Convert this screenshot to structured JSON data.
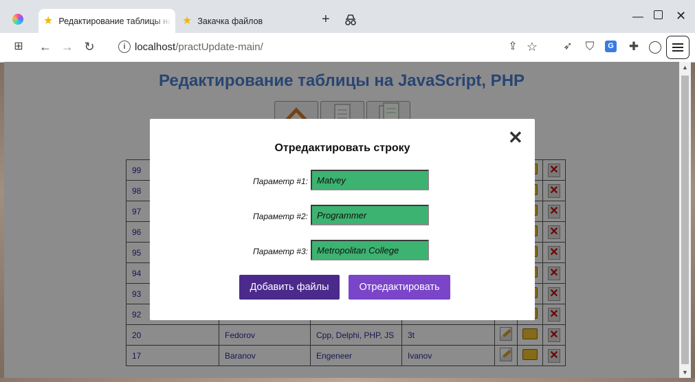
{
  "browser": {
    "tabs": [
      {
        "title": "Редактирование таблицы на JavaScript, PHP",
        "active": true
      },
      {
        "title": "Закачка файлов",
        "active": false
      }
    ],
    "url": {
      "host": "localhost",
      "path": "/practUpdate-main/"
    }
  },
  "page": {
    "title": "Редактирование таблицы на JavaScript, PHP",
    "table": {
      "rows": [
        {
          "id": "99",
          "c2": "",
          "c3": "",
          "c4": ""
        },
        {
          "id": "98",
          "c2": "",
          "c3": "",
          "c4": ""
        },
        {
          "id": "97",
          "c2": "",
          "c3": "",
          "c4": ""
        },
        {
          "id": "96",
          "c2": "",
          "c3": "",
          "c4": ""
        },
        {
          "id": "95",
          "c2": "",
          "c3": "",
          "c4": ""
        },
        {
          "id": "94",
          "c2": "",
          "c3": "",
          "c4": ""
        },
        {
          "id": "93",
          "c2": "",
          "c3": "",
          "c4": ""
        },
        {
          "id": "92",
          "c2": "",
          "c3": "",
          "c4": ""
        },
        {
          "id": "20",
          "c2": "Fedorov",
          "c3": "Cpp, Delphi, PHP, JS",
          "c4": "3t"
        },
        {
          "id": "17",
          "c2": "Baranov",
          "c3": "Engeneer",
          "c4": "Ivanov"
        }
      ]
    }
  },
  "modal": {
    "title": "Отредактировать строку",
    "fields": [
      {
        "label": "Параметр #1:",
        "value": "Matvey"
      },
      {
        "label": "Параметр #2:",
        "value": "Programmer"
      },
      {
        "label": "Параметр #3:",
        "value": "Metropolitan College"
      }
    ],
    "add_files_label": "Добавить файлы",
    "submit_label": "Отредактировать",
    "close_glyph": "✕"
  },
  "colors": {
    "input_bg": "#3cb371",
    "btn_dark": "#4b2a8c",
    "btn_light": "#7a45c8",
    "title": "#4a7fd1"
  }
}
